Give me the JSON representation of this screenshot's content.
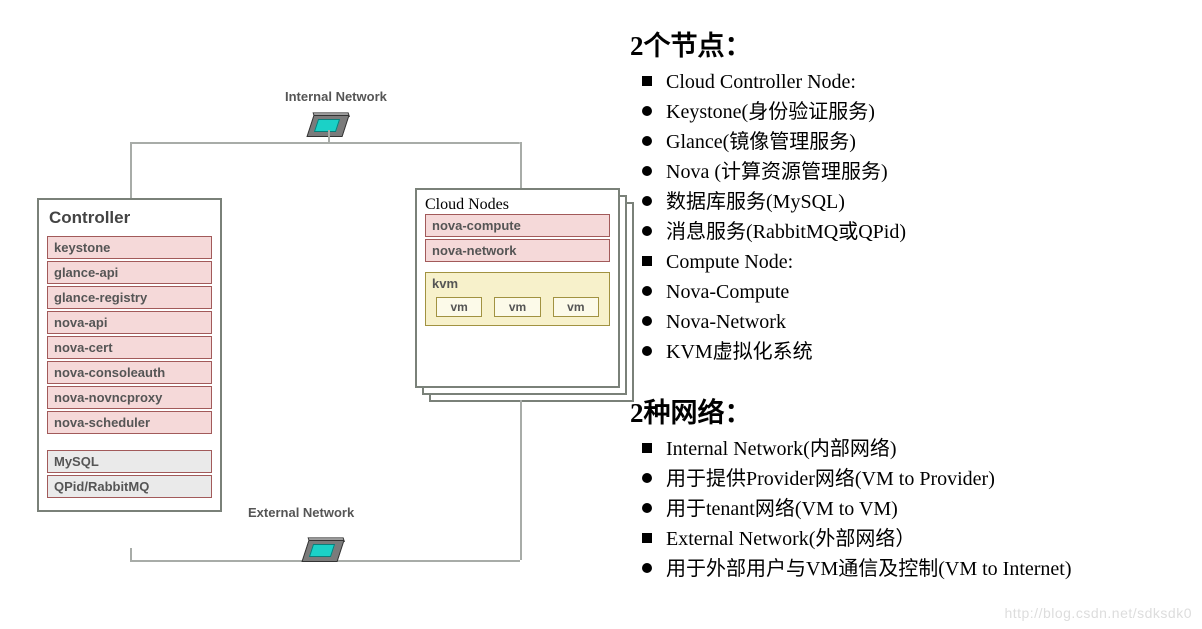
{
  "diagram": {
    "internal_label": "Internal Network",
    "external_label": "External Network",
    "controller": {
      "title": "Controller",
      "services": [
        "keystone",
        "glance-api",
        "glance-registry",
        "nova-api",
        "nova-cert",
        "nova-consoleauth",
        "nova-novncproxy",
        "nova-scheduler"
      ],
      "infra": [
        "MySQL",
        "QPid/RabbitMQ"
      ]
    },
    "cloud": {
      "title": "Cloud Nodes",
      "services": [
        "nova-compute",
        "nova-network"
      ],
      "kvm_label": "kvm",
      "vms": [
        "vm",
        "vm",
        "vm"
      ]
    }
  },
  "text": {
    "h1": "2个节点：",
    "nodes": [
      {
        "sq": true,
        "t": "Cloud Controller Node:"
      },
      {
        "sq": false,
        "t": "Keystone(身份验证服务)"
      },
      {
        "sq": false,
        "t": "Glance(镜像管理服务)"
      },
      {
        "sq": false,
        "t": "Nova (计算资源管理服务)"
      },
      {
        "sq": false,
        "t": "数据库服务(MySQL)"
      },
      {
        "sq": false,
        "t": "消息服务(RabbitMQ或QPid)"
      },
      {
        "sq": true,
        "t": "Compute Node:"
      },
      {
        "sq": false,
        "t": "Nova-Compute"
      },
      {
        "sq": false,
        "t": "Nova-Network"
      },
      {
        "sq": false,
        "t": "KVM虚拟化系统"
      }
    ],
    "h2": "2种网络：",
    "nets": [
      {
        "sq": true,
        "t": "Internal Network(内部网络)"
      },
      {
        "sq": false,
        "t": "用于提供Provider网络(VM to Provider)"
      },
      {
        "sq": false,
        "t": "用于tenant网络(VM to VM)"
      },
      {
        "sq": true,
        "t": "External Network(外部网络）"
      },
      {
        "sq": false,
        "t": "用于外部用户与VM通信及控制(VM to Internet)"
      }
    ]
  },
  "watermark": "http://blog.csdn.net/sdksdk0"
}
